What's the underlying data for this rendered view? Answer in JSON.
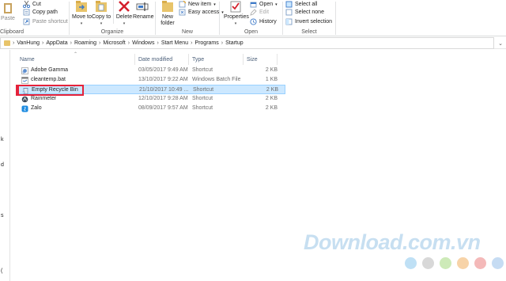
{
  "ribbon": {
    "clipboard": {
      "group_label": "Clipboard",
      "paste_label": "Paste",
      "cut_label": "Cut",
      "copy_path_label": "Copy path",
      "paste_shortcut_label": "Paste shortcut"
    },
    "organize": {
      "group_label": "Organize",
      "move_to_label": "Move to",
      "copy_to_label": "Copy to",
      "delete_label": "Delete",
      "rename_label": "Rename"
    },
    "new": {
      "group_label": "New",
      "new_folder_label": "New folder",
      "new_item_label": "New item",
      "easy_access_label": "Easy access"
    },
    "open": {
      "group_label": "Open",
      "properties_label": "Properties",
      "open_label": "Open",
      "edit_label": "Edit",
      "history_label": "History"
    },
    "select": {
      "group_label": "Select",
      "select_all_label": "Select all",
      "select_none_label": "Select none",
      "invert_selection_label": "Invert selection"
    }
  },
  "address_bar": {
    "crumbs": [
      "VanHung",
      "AppData",
      "Roaming",
      "Microsoft",
      "Windows",
      "Start Menu",
      "Programs",
      "Startup"
    ],
    "separator": "›"
  },
  "navpane": {
    "fragments": [
      "k",
      "d",
      "s",
      "("
    ]
  },
  "file_list": {
    "columns": {
      "name": "Name",
      "date": "Date modified",
      "type": "Type",
      "size": "Size"
    },
    "rows": [
      {
        "name": "Adobe Gamma",
        "date": "03/05/2017 9:49 AM",
        "type": "Shortcut",
        "size": "2 KB",
        "icon": "adobe-gamma-shortcut-icon"
      },
      {
        "name": "cleantemp.bat",
        "date": "13/10/2017 9:22 AM",
        "type": "Windows Batch File",
        "size": "1 KB",
        "icon": "batch-file-icon"
      },
      {
        "name": "Empty Recycle Bin",
        "date": "21/10/2017 10:49 ...",
        "type": "Shortcut",
        "size": "2 KB",
        "icon": "recycle-bin-shortcut-icon",
        "selected": true
      },
      {
        "name": "Rainmeter",
        "date": "12/10/2017 9:28 AM",
        "type": "Shortcut",
        "size": "2 KB",
        "icon": "rainmeter-shortcut-icon"
      },
      {
        "name": "Zalo",
        "date": "08/09/2017 9:57 AM",
        "type": "Shortcut",
        "size": "2 KB",
        "icon": "zalo-shortcut-icon"
      }
    ]
  },
  "watermark": {
    "text": "Download.com.vn",
    "dot_colors": [
      "#bfe0f5",
      "#d8d8d8",
      "#cdeab8",
      "#f7d3a8",
      "#f4b9b9",
      "#c6dcf3"
    ]
  },
  "colors": {
    "selection_bg": "#cce8ff",
    "selection_border": "#99d1ff",
    "highlight_box": "#e5223a",
    "watermark": "#c7dff1"
  }
}
